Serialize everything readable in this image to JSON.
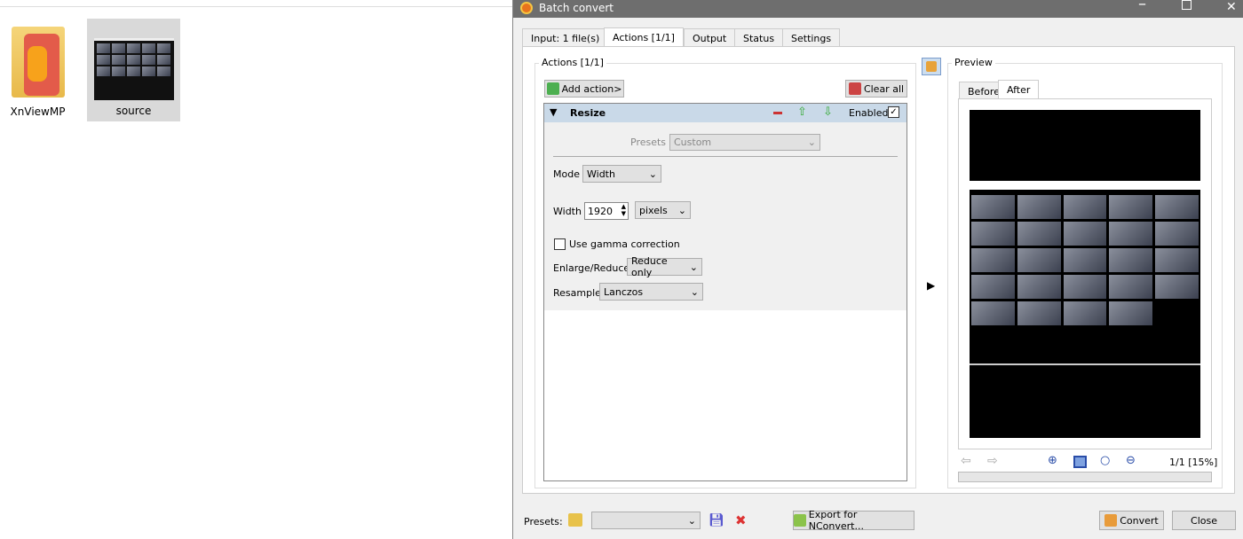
{
  "desktop": {
    "icons": [
      {
        "label": "XnViewMP"
      },
      {
        "label": "source"
      }
    ]
  },
  "window": {
    "title": "Batch convert",
    "tabs": [
      "Input: 1 file(s)",
      "Actions [1/1]",
      "Output",
      "Status",
      "Settings"
    ],
    "actions": {
      "group_label": "Actions [1/1]",
      "add_action": "Add action>",
      "clear_all": "Clear all",
      "resize": {
        "title": "Resize",
        "enabled_label": "Enabled",
        "enabled": true,
        "presets_label": "Presets",
        "presets_value": "Custom",
        "mode_label": "Mode",
        "mode_value": "Width",
        "width_label": "Width",
        "width_value": "1920",
        "unit_value": "pixels",
        "gamma_label": "Use gamma correction",
        "gamma_checked": false,
        "enlarge_label": "Enlarge/Reduce",
        "enlarge_value": "Reduce only",
        "resample_label": "Resample",
        "resample_value": "Lanczos"
      }
    },
    "preview": {
      "group_label": "Preview",
      "tabs": [
        "Before",
        "After"
      ],
      "page_info": "1/1 [15%]"
    },
    "footer": {
      "presets_label": "Presets:",
      "presets_value": "",
      "export": "Export for NConvert...",
      "convert": "Convert",
      "close": "Close"
    }
  }
}
